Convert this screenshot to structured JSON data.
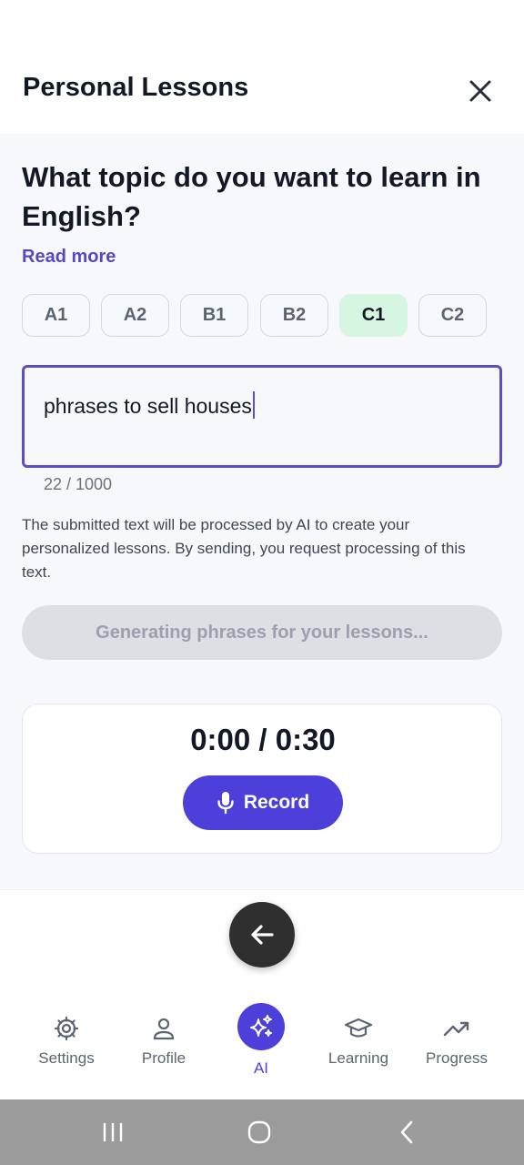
{
  "header": {
    "title": "Personal Lessons",
    "close_icon": "close-icon"
  },
  "main": {
    "question": "What topic do you want to learn in English?",
    "read_more": "Read more",
    "levels": [
      {
        "label": "A1",
        "selected": false
      },
      {
        "label": "A2",
        "selected": false
      },
      {
        "label": "B1",
        "selected": false
      },
      {
        "label": "B2",
        "selected": false
      },
      {
        "label": "C1",
        "selected": true
      },
      {
        "label": "C2",
        "selected": false
      }
    ],
    "topic_input": {
      "value": "phrases to sell houses"
    },
    "char_counter": "22 / 1000",
    "disclaimer": "The submitted text will be processed by AI to create your personalized lessons. By sending, you request processing of this text.",
    "generating_label": "Generating phrases for your lessons...",
    "recorder": {
      "timer": "0:00 / 0:30",
      "record_label": "Record"
    }
  },
  "bottom_nav": {
    "items": [
      {
        "label": "Settings",
        "icon": "gear-icon"
      },
      {
        "label": "Profile",
        "icon": "person-icon"
      },
      {
        "label": "AI",
        "icon": "sparkles-icon",
        "active": true
      },
      {
        "label": "Learning",
        "icon": "graduation-cap-icon"
      },
      {
        "label": "Progress",
        "icon": "trend-up-icon"
      }
    ]
  },
  "colors": {
    "accent": "#4d3fd9",
    "selected_level_bg": "#d6f6e1",
    "link": "#5448c8"
  }
}
